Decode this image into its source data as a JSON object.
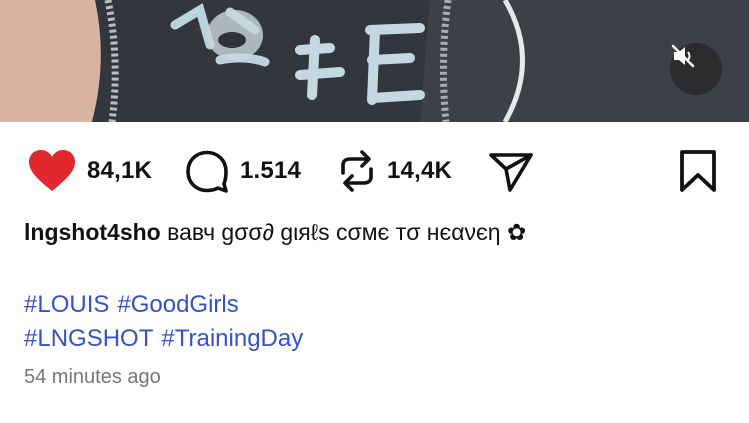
{
  "media": {
    "mute_icon": "speaker-muted-icon"
  },
  "actions": {
    "like": {
      "icon": "heart-icon",
      "count": "84,1K",
      "color": "#e0282f"
    },
    "comment": {
      "icon": "comment-icon",
      "count": "1.514"
    },
    "repost": {
      "icon": "repost-icon",
      "count": "14,4K"
    },
    "share": {
      "icon": "send-icon"
    },
    "save": {
      "icon": "bookmark-icon"
    }
  },
  "caption": {
    "username": "lngshot4sho",
    "text": "вавч gσσ∂ gιяℓѕ cσмє тσ нєανєη ✿"
  },
  "hashtags": [
    [
      "#LOUIS",
      "#GoodGirls"
    ],
    [
      "#LNGSHOT",
      "#TrainingDay"
    ]
  ],
  "timestamp": "54 minutes ago",
  "colors": {
    "hashtag": "#3552c8",
    "like": "#e0282f",
    "timestamp": "#777777"
  }
}
